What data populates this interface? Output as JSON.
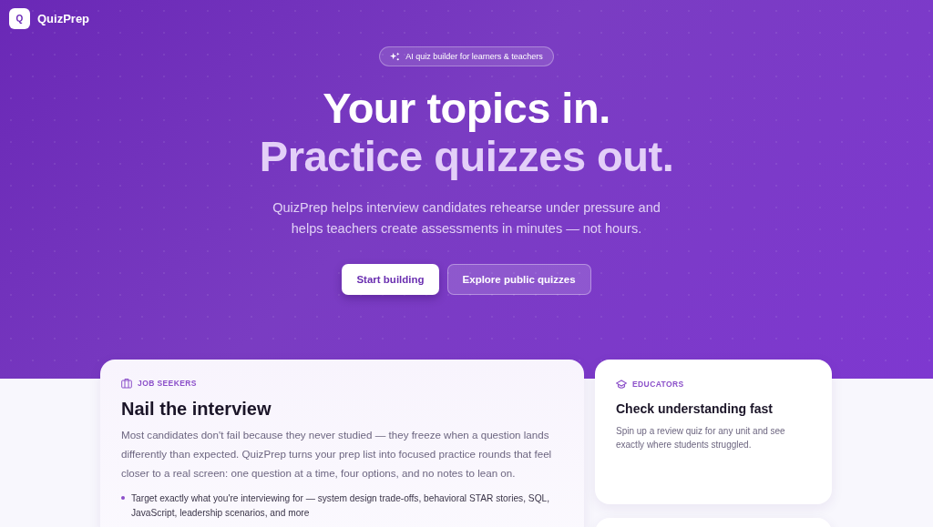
{
  "brand": {
    "logo_letter": "Q",
    "name": "QuizPrep"
  },
  "hero": {
    "badge": "AI quiz builder for learners & teachers",
    "headline": [
      "Your topics in.",
      "Practice quizzes out."
    ],
    "description": "QuizPrep helps interview candidates rehearse under pressure and helps teachers create assessments in minutes — not hours.",
    "buttons": [
      {
        "label": "Start building",
        "kind": "primary"
      },
      {
        "label": "Explore public quizzes",
        "kind": "secondary"
      }
    ]
  },
  "cards": [
    {
      "kind": "main",
      "eyebrow": "JOB SEEKERS",
      "title": "Nail the interview",
      "body": "Most candidates don't fail because they never studied — they freeze when a question lands differently than expected. QuizPrep turns your prep list into focused practice rounds that feel closer to a real screen: one question at a time, four options, and no notes to lean on.",
      "bullets": [
        "Target exactly what you're interviewing for — system design trade-offs, behavioral STAR stories, SQL, JavaScript, leadership scenarios, and more"
      ]
    },
    {
      "kind": "side",
      "eyebrow": "EDUCATORS",
      "title": "Check understanding fast",
      "body": "Spin up a review quiz for any unit and see exactly where students struggled."
    }
  ]
}
